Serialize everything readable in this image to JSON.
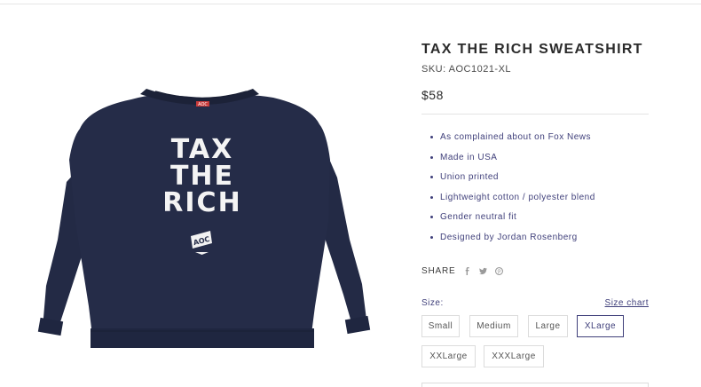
{
  "product": {
    "title": "TAX THE RICH SWEATSHIRT",
    "sku": "SKU: AOC1021-XL",
    "price": "$58",
    "features": [
      "As complained about on Fox News",
      "Made in USA",
      "Union printed",
      "Lightweight cotton / polyester blend",
      "Gender neutral fit",
      "Designed by Jordan Rosenberg"
    ]
  },
  "image": {
    "print_lines": [
      "TAX",
      "THE",
      "RICH"
    ],
    "badge_text": "AOC",
    "garment_color": "#252c48"
  },
  "share": {
    "label": "SHARE",
    "icons": [
      "facebook-icon",
      "twitter-icon",
      "pinterest-icon"
    ]
  },
  "size": {
    "label": "Size:",
    "chart_link": "Size chart",
    "options": [
      "Small",
      "Medium",
      "Large",
      "XLarge",
      "XXLarge",
      "XXXLarge"
    ],
    "selected": "XLarge"
  },
  "colors": {
    "accent": "#3f3f7a",
    "text": "#2b2b2b",
    "border": "#dcdcdc"
  }
}
